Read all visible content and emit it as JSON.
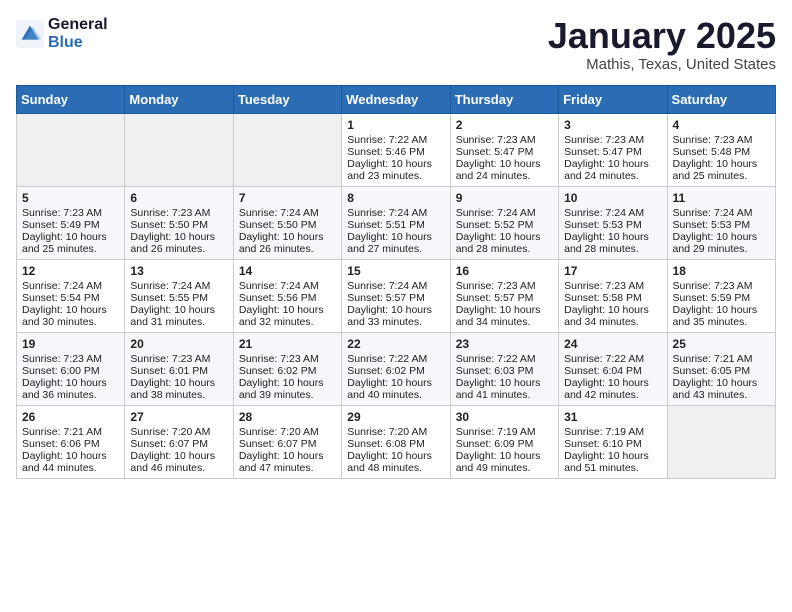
{
  "logo": {
    "general": "General",
    "blue": "Blue"
  },
  "title": "January 2025",
  "location": "Mathis, Texas, United States",
  "days_header": [
    "Sunday",
    "Monday",
    "Tuesday",
    "Wednesday",
    "Thursday",
    "Friday",
    "Saturday"
  ],
  "weeks": [
    [
      {
        "num": "",
        "sunrise": "",
        "sunset": "",
        "daylight": ""
      },
      {
        "num": "",
        "sunrise": "",
        "sunset": "",
        "daylight": ""
      },
      {
        "num": "",
        "sunrise": "",
        "sunset": "",
        "daylight": ""
      },
      {
        "num": "1",
        "sunrise": "Sunrise: 7:22 AM",
        "sunset": "Sunset: 5:46 PM",
        "daylight": "Daylight: 10 hours and 23 minutes."
      },
      {
        "num": "2",
        "sunrise": "Sunrise: 7:23 AM",
        "sunset": "Sunset: 5:47 PM",
        "daylight": "Daylight: 10 hours and 24 minutes."
      },
      {
        "num": "3",
        "sunrise": "Sunrise: 7:23 AM",
        "sunset": "Sunset: 5:47 PM",
        "daylight": "Daylight: 10 hours and 24 minutes."
      },
      {
        "num": "4",
        "sunrise": "Sunrise: 7:23 AM",
        "sunset": "Sunset: 5:48 PM",
        "daylight": "Daylight: 10 hours and 25 minutes."
      }
    ],
    [
      {
        "num": "5",
        "sunrise": "Sunrise: 7:23 AM",
        "sunset": "Sunset: 5:49 PM",
        "daylight": "Daylight: 10 hours and 25 minutes."
      },
      {
        "num": "6",
        "sunrise": "Sunrise: 7:23 AM",
        "sunset": "Sunset: 5:50 PM",
        "daylight": "Daylight: 10 hours and 26 minutes."
      },
      {
        "num": "7",
        "sunrise": "Sunrise: 7:24 AM",
        "sunset": "Sunset: 5:50 PM",
        "daylight": "Daylight: 10 hours and 26 minutes."
      },
      {
        "num": "8",
        "sunrise": "Sunrise: 7:24 AM",
        "sunset": "Sunset: 5:51 PM",
        "daylight": "Daylight: 10 hours and 27 minutes."
      },
      {
        "num": "9",
        "sunrise": "Sunrise: 7:24 AM",
        "sunset": "Sunset: 5:52 PM",
        "daylight": "Daylight: 10 hours and 28 minutes."
      },
      {
        "num": "10",
        "sunrise": "Sunrise: 7:24 AM",
        "sunset": "Sunset: 5:53 PM",
        "daylight": "Daylight: 10 hours and 28 minutes."
      },
      {
        "num": "11",
        "sunrise": "Sunrise: 7:24 AM",
        "sunset": "Sunset: 5:53 PM",
        "daylight": "Daylight: 10 hours and 29 minutes."
      }
    ],
    [
      {
        "num": "12",
        "sunrise": "Sunrise: 7:24 AM",
        "sunset": "Sunset: 5:54 PM",
        "daylight": "Daylight: 10 hours and 30 minutes."
      },
      {
        "num": "13",
        "sunrise": "Sunrise: 7:24 AM",
        "sunset": "Sunset: 5:55 PM",
        "daylight": "Daylight: 10 hours and 31 minutes."
      },
      {
        "num": "14",
        "sunrise": "Sunrise: 7:24 AM",
        "sunset": "Sunset: 5:56 PM",
        "daylight": "Daylight: 10 hours and 32 minutes."
      },
      {
        "num": "15",
        "sunrise": "Sunrise: 7:24 AM",
        "sunset": "Sunset: 5:57 PM",
        "daylight": "Daylight: 10 hours and 33 minutes."
      },
      {
        "num": "16",
        "sunrise": "Sunrise: 7:23 AM",
        "sunset": "Sunset: 5:57 PM",
        "daylight": "Daylight: 10 hours and 34 minutes."
      },
      {
        "num": "17",
        "sunrise": "Sunrise: 7:23 AM",
        "sunset": "Sunset: 5:58 PM",
        "daylight": "Daylight: 10 hours and 34 minutes."
      },
      {
        "num": "18",
        "sunrise": "Sunrise: 7:23 AM",
        "sunset": "Sunset: 5:59 PM",
        "daylight": "Daylight: 10 hours and 35 minutes."
      }
    ],
    [
      {
        "num": "19",
        "sunrise": "Sunrise: 7:23 AM",
        "sunset": "Sunset: 6:00 PM",
        "daylight": "Daylight: 10 hours and 36 minutes."
      },
      {
        "num": "20",
        "sunrise": "Sunrise: 7:23 AM",
        "sunset": "Sunset: 6:01 PM",
        "daylight": "Daylight: 10 hours and 38 minutes."
      },
      {
        "num": "21",
        "sunrise": "Sunrise: 7:23 AM",
        "sunset": "Sunset: 6:02 PM",
        "daylight": "Daylight: 10 hours and 39 minutes."
      },
      {
        "num": "22",
        "sunrise": "Sunrise: 7:22 AM",
        "sunset": "Sunset: 6:02 PM",
        "daylight": "Daylight: 10 hours and 40 minutes."
      },
      {
        "num": "23",
        "sunrise": "Sunrise: 7:22 AM",
        "sunset": "Sunset: 6:03 PM",
        "daylight": "Daylight: 10 hours and 41 minutes."
      },
      {
        "num": "24",
        "sunrise": "Sunrise: 7:22 AM",
        "sunset": "Sunset: 6:04 PM",
        "daylight": "Daylight: 10 hours and 42 minutes."
      },
      {
        "num": "25",
        "sunrise": "Sunrise: 7:21 AM",
        "sunset": "Sunset: 6:05 PM",
        "daylight": "Daylight: 10 hours and 43 minutes."
      }
    ],
    [
      {
        "num": "26",
        "sunrise": "Sunrise: 7:21 AM",
        "sunset": "Sunset: 6:06 PM",
        "daylight": "Daylight: 10 hours and 44 minutes."
      },
      {
        "num": "27",
        "sunrise": "Sunrise: 7:20 AM",
        "sunset": "Sunset: 6:07 PM",
        "daylight": "Daylight: 10 hours and 46 minutes."
      },
      {
        "num": "28",
        "sunrise": "Sunrise: 7:20 AM",
        "sunset": "Sunset: 6:07 PM",
        "daylight": "Daylight: 10 hours and 47 minutes."
      },
      {
        "num": "29",
        "sunrise": "Sunrise: 7:20 AM",
        "sunset": "Sunset: 6:08 PM",
        "daylight": "Daylight: 10 hours and 48 minutes."
      },
      {
        "num": "30",
        "sunrise": "Sunrise: 7:19 AM",
        "sunset": "Sunset: 6:09 PM",
        "daylight": "Daylight: 10 hours and 49 minutes."
      },
      {
        "num": "31",
        "sunrise": "Sunrise: 7:19 AM",
        "sunset": "Sunset: 6:10 PM",
        "daylight": "Daylight: 10 hours and 51 minutes."
      },
      {
        "num": "",
        "sunrise": "",
        "sunset": "",
        "daylight": ""
      }
    ]
  ]
}
